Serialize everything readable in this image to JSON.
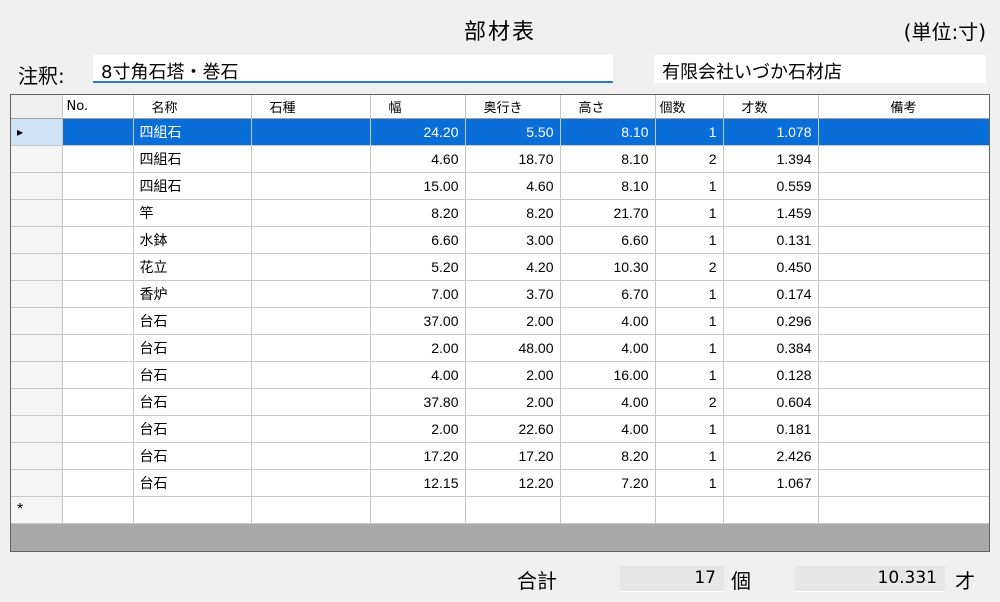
{
  "header": {
    "title": "部材表",
    "unit": "(単位:寸)"
  },
  "note": {
    "label": "注釈:",
    "value": "8寸角石塔・巻石"
  },
  "company": "有限会社いづか石材店",
  "table": {
    "columns": [
      "No.",
      "名称",
      "石種",
      "幅",
      "奥行き",
      "高さ",
      "個数",
      "才数",
      "備考"
    ],
    "selected_marker": "▸",
    "new_row_marker": "*",
    "rows": [
      {
        "no": "",
        "name": "四組石",
        "stone": "",
        "width": "24.20",
        "depth": "5.50",
        "height": "8.10",
        "qty": "1",
        "sai": "1.078",
        "remarks": ""
      },
      {
        "no": "",
        "name": "四組石",
        "stone": "",
        "width": "4.60",
        "depth": "18.70",
        "height": "8.10",
        "qty": "2",
        "sai": "1.394",
        "remarks": ""
      },
      {
        "no": "",
        "name": "四組石",
        "stone": "",
        "width": "15.00",
        "depth": "4.60",
        "height": "8.10",
        "qty": "1",
        "sai": "0.559",
        "remarks": ""
      },
      {
        "no": "",
        "name": "竿",
        "stone": "",
        "width": "8.20",
        "depth": "8.20",
        "height": "21.70",
        "qty": "1",
        "sai": "1.459",
        "remarks": ""
      },
      {
        "no": "",
        "name": "水鉢",
        "stone": "",
        "width": "6.60",
        "depth": "3.00",
        "height": "6.60",
        "qty": "1",
        "sai": "0.131",
        "remarks": ""
      },
      {
        "no": "",
        "name": "花立",
        "stone": "",
        "width": "5.20",
        "depth": "4.20",
        "height": "10.30",
        "qty": "2",
        "sai": "0.450",
        "remarks": ""
      },
      {
        "no": "",
        "name": "香炉",
        "stone": "",
        "width": "7.00",
        "depth": "3.70",
        "height": "6.70",
        "qty": "1",
        "sai": "0.174",
        "remarks": ""
      },
      {
        "no": "",
        "name": "台石",
        "stone": "",
        "width": "37.00",
        "depth": "2.00",
        "height": "4.00",
        "qty": "1",
        "sai": "0.296",
        "remarks": ""
      },
      {
        "no": "",
        "name": "台石",
        "stone": "",
        "width": "2.00",
        "depth": "48.00",
        "height": "4.00",
        "qty": "1",
        "sai": "0.384",
        "remarks": ""
      },
      {
        "no": "",
        "name": "台石",
        "stone": "",
        "width": "4.00",
        "depth": "2.00",
        "height": "16.00",
        "qty": "1",
        "sai": "0.128",
        "remarks": ""
      },
      {
        "no": "",
        "name": "台石",
        "stone": "",
        "width": "37.80",
        "depth": "2.00",
        "height": "4.00",
        "qty": "2",
        "sai": "0.604",
        "remarks": ""
      },
      {
        "no": "",
        "name": "台石",
        "stone": "",
        "width": "2.00",
        "depth": "22.60",
        "height": "4.00",
        "qty": "1",
        "sai": "0.181",
        "remarks": ""
      },
      {
        "no": "",
        "name": "台石",
        "stone": "",
        "width": "17.20",
        "depth": "17.20",
        "height": "8.20",
        "qty": "1",
        "sai": "2.426",
        "remarks": ""
      },
      {
        "no": "",
        "name": "台石",
        "stone": "",
        "width": "12.15",
        "depth": "12.20",
        "height": "7.20",
        "qty": "1",
        "sai": "1.067",
        "remarks": ""
      }
    ]
  },
  "footer": {
    "total_label": "合計",
    "total_count": "17",
    "count_unit": "個",
    "total_sai": "10.331",
    "sai_unit": "才"
  },
  "colors": {
    "selection": "#0a6ed9",
    "focus_underline": "#2a78d8",
    "grid_empty_area": "#a8a8a8"
  }
}
